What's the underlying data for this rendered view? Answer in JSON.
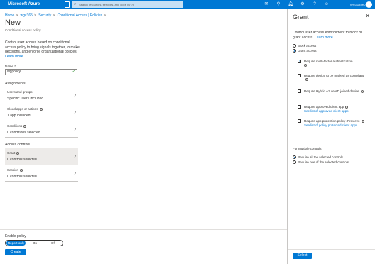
{
  "topbar": {
    "brand": "Microsoft Azure",
    "search_placeholder": "Search resources, services, and docs (G+/)",
    "user": "WSGDEMO",
    "icons": [
      "mail-icon",
      "filter-icon",
      "bell-icon",
      "gear-icon",
      "help-icon",
      "feedback-icon"
    ]
  },
  "breadcrumb": [
    "Home",
    "wgc365",
    "Security",
    "Conditional Access | Policies"
  ],
  "page": {
    "title": "New",
    "subtitle": "Conditional access policy",
    "description": "Control user access based on conditional access policy to bring signals together, to make decisions, and enforce organizational policies.",
    "learn_more": "Learn more"
  },
  "name_field": {
    "label": "Name *",
    "value": "wgpolicy"
  },
  "assignments": {
    "heading": "Assignments",
    "tiles": [
      {
        "title": "Users and groups",
        "value": "Specific users included"
      },
      {
        "title": "Cloud apps or actions",
        "value": "1 app included"
      },
      {
        "title": "Conditions",
        "value": "0 conditions selected"
      }
    ]
  },
  "access_controls": {
    "heading": "Access controls",
    "tiles": [
      {
        "title": "Grant",
        "value": "0 controls selected"
      },
      {
        "title": "Session",
        "value": "0 controls selected"
      }
    ]
  },
  "enable_policy": {
    "label": "Enable policy",
    "options": [
      "Report-only",
      "On",
      "Off"
    ],
    "selected": "Report-only"
  },
  "create_label": "Create",
  "grant": {
    "title": "Grant",
    "description": "Control user access enforcement to block or grant access.",
    "learn_more": "Learn more",
    "block_label": "Block access",
    "grant_label": "Grant access",
    "grant_selected": true,
    "controls": [
      {
        "label": "Require multi-factor authentication",
        "checked": true,
        "link": ""
      },
      {
        "label": "Require device to be marked as compliant",
        "checked": false,
        "link": ""
      },
      {
        "label": "Require Hybrid Azure AD joined device",
        "checked": false,
        "link": ""
      },
      {
        "label": "Require approved client app",
        "checked": false,
        "link": "See list of approved client apps"
      },
      {
        "label": "Require app protection policy (Preview)",
        "checked": false,
        "link": "See list of policy protected client apps"
      }
    ],
    "multiple_label": "For multiple controls",
    "require_all": "Require all the selected controls",
    "require_one": "Require one of the selected controls",
    "select_label": "Select"
  },
  "colors": {
    "accent": "#0078d4",
    "success": "#107c10"
  }
}
